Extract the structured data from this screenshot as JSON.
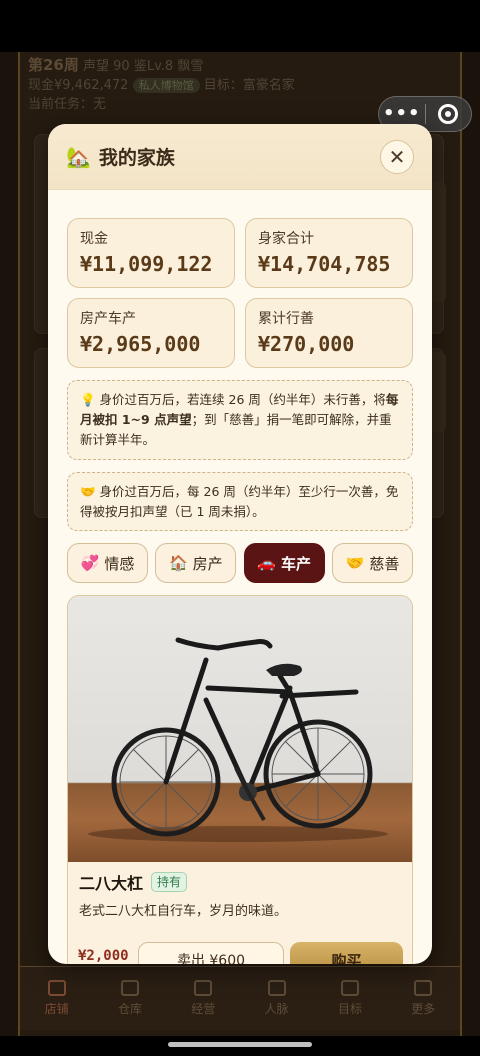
{
  "background": {
    "week": "第26周",
    "reputation": "声望 90",
    "appraisal": "鉴Lv.8",
    "weather": "飘雪",
    "cash_line": "现金¥9,462,472",
    "museum_chip": "私人博物馆",
    "goal": "目标：富豪名家",
    "task": "当前任务：无"
  },
  "tabbar": [
    {
      "label": "店铺"
    },
    {
      "label": "仓库"
    },
    {
      "label": "经营"
    },
    {
      "label": "人脉"
    },
    {
      "label": "目标"
    },
    {
      "label": "更多"
    }
  ],
  "capsule": {
    "more_icon": "•••",
    "target_icon": "target-icon"
  },
  "modal": {
    "title": "我的家族",
    "close": "✕",
    "stats": [
      {
        "label": "现金",
        "value": "¥11,099,122"
      },
      {
        "label": "身家合计",
        "value": "¥14,704,785"
      },
      {
        "label": "房产车产",
        "value": "¥2,965,000"
      },
      {
        "label": "累计行善",
        "value": "¥270,000"
      }
    ],
    "notice1": {
      "icon": "💡",
      "part1": " 身价过百万后，若连续 26 周（约半年）未行善，将",
      "bold": "每月被扣 1~9 点声望",
      "part2": "；到「慈善」捐一笔即可解除，并重新计算半年。"
    },
    "notice2": {
      "icon": "🤝",
      "text": " 身价过百万后，每 26 周（约半年）至少行一次善，免得被按月扣声望（已 1 周未捐）。"
    },
    "tabs": [
      {
        "icon": "💞",
        "label": "情感"
      },
      {
        "icon": "🏠",
        "label": "房产"
      },
      {
        "icon": "🚗",
        "label": "车产"
      },
      {
        "icon": "🤝",
        "label": "慈善"
      }
    ],
    "item": {
      "name": "二八大杠",
      "badge": "持有",
      "desc": "老式二八大杠自行车，岁月的味道。",
      "price": "¥2,000",
      "sell": "卖出 ¥600",
      "buy": "购买"
    }
  }
}
